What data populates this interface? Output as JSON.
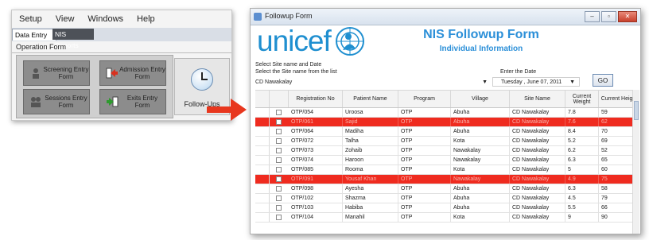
{
  "left_window": {
    "menu": [
      "Setup",
      "View",
      "Windows",
      "Help"
    ],
    "tabs": {
      "active": "Data Entry",
      "other": "NIS Reports"
    },
    "section_title": "Operation Form",
    "buttons": [
      {
        "label": "Screening Entry Form",
        "icon": "screening-icon"
      },
      {
        "label": "Admission Entry Form",
        "icon": "admission-arrow-icon"
      },
      {
        "label": "Sessions Entry Form",
        "icon": "sessions-icon"
      },
      {
        "label": "Exits Entry Form",
        "icon": "exit-arrow-icon"
      }
    ],
    "followups_label": "Follow-Ups",
    "followups_icon": "clock-icon"
  },
  "arrow_color": "#e8371e",
  "right_window": {
    "title": "Followup Form",
    "window_buttons": [
      "minimize",
      "maximize",
      "close"
    ],
    "logo_text": "unicef",
    "form_title": "NIS Followup Form",
    "form_subtitle": "Individual Information",
    "label_select_site": "Select Site name and Date",
    "label_select_from_list": "Select the Site name from the list",
    "site_value": "CD Nawakalay",
    "label_enter_date": "Enter the Date",
    "date_value": "Tuesday ,   June   07, 2011",
    "go_label": "GO",
    "columns": [
      "Registration No",
      "Patient Name",
      "Program",
      "Village",
      "Site Name",
      "Current Weight",
      "Current Height"
    ],
    "rows": [
      {
        "reg": "OTP/054",
        "name": "Uroosa",
        "program": "OTP",
        "village": "Abuha",
        "site": "CD Nawakalay",
        "weight": "7.8",
        "height": "59",
        "highlight": false
      },
      {
        "reg": "OTP/061",
        "name": "Sajid",
        "program": "OTP",
        "village": "Abuha",
        "site": "CD Nawakalay",
        "weight": "7.6",
        "height": "62",
        "highlight": true
      },
      {
        "reg": "OTP/064",
        "name": "Madiha",
        "program": "OTP",
        "village": "Abuha",
        "site": "CD Nawakalay",
        "weight": "8.4",
        "height": "70",
        "highlight": false
      },
      {
        "reg": "OTP/072",
        "name": "Talha",
        "program": "OTP",
        "village": "Kota",
        "site": "CD Nawakalay",
        "weight": "5.2",
        "height": "69",
        "highlight": false
      },
      {
        "reg": "OTP/073",
        "name": "Zohaib",
        "program": "OTP",
        "village": "Nawakalay",
        "site": "CD Nawakalay",
        "weight": "6.2",
        "height": "52",
        "highlight": false
      },
      {
        "reg": "OTP/074",
        "name": "Haroon",
        "program": "OTP",
        "village": "Nawakalay",
        "site": "CD Nawakalay",
        "weight": "6.3",
        "height": "65",
        "highlight": false
      },
      {
        "reg": "OTP/085",
        "name": "Rooma",
        "program": "OTP",
        "village": "Kota",
        "site": "CD Nawakalay",
        "weight": "5",
        "height": "60",
        "highlight": false
      },
      {
        "reg": "OTP/091",
        "name": "Yousaf Khan",
        "program": "OTP",
        "village": "Nawakalay",
        "site": "CD Nawakalay",
        "weight": "4.9",
        "height": "75",
        "highlight": true
      },
      {
        "reg": "OTP/098",
        "name": "Ayesha",
        "program": "OTP",
        "village": "Abuha",
        "site": "CD Nawakalay",
        "weight": "6.3",
        "height": "58",
        "highlight": false
      },
      {
        "reg": "OTP/102",
        "name": "Shazma",
        "program": "OTP",
        "village": "Abuha",
        "site": "CD Nawakalay",
        "weight": "4.5",
        "height": "79",
        "highlight": false
      },
      {
        "reg": "OTP/103",
        "name": "Habiba",
        "program": "OTP",
        "village": "Abuha",
        "site": "CD Nawakalay",
        "weight": "5.5",
        "height": "66",
        "highlight": false
      },
      {
        "reg": "OTP/104",
        "name": "Manahil",
        "program": "OTP",
        "village": "Kota",
        "site": "CD Nawakalay",
        "weight": "9",
        "height": "90",
        "highlight": false
      }
    ]
  }
}
